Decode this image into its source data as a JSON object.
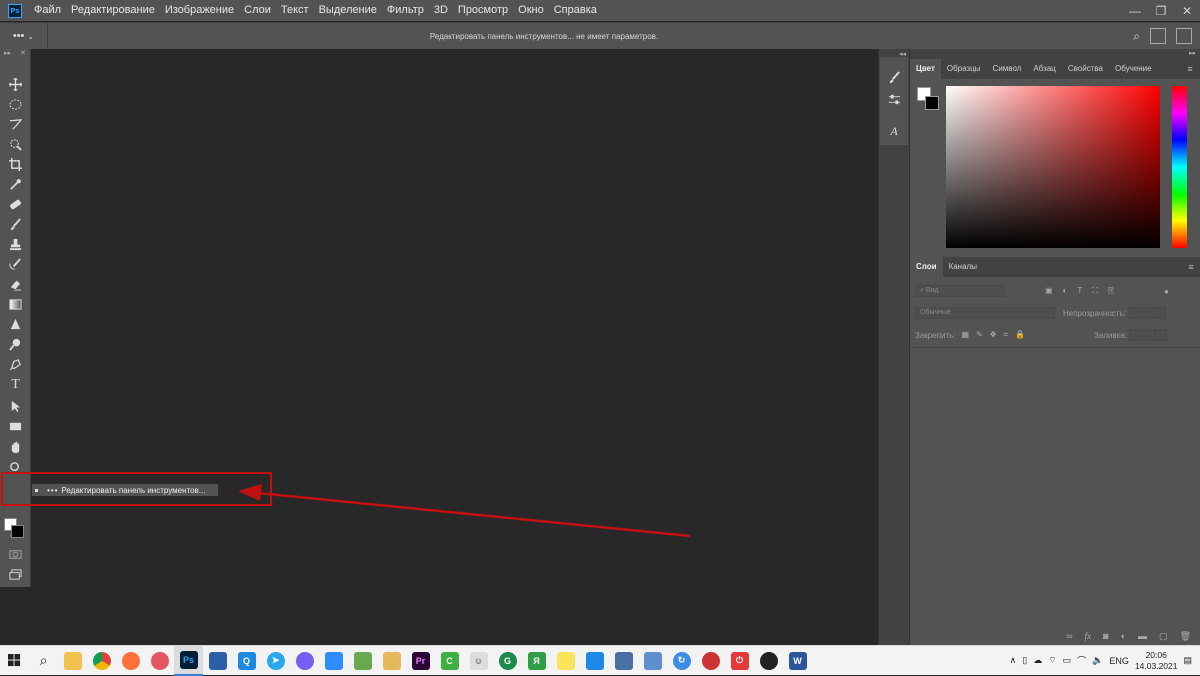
{
  "app": {
    "logo": "Ps"
  },
  "menu": [
    "Файл",
    "Редактирование",
    "Изображение",
    "Слои",
    "Текст",
    "Выделение",
    "Фильтр",
    "3D",
    "Просмотр",
    "Окно",
    "Справка"
  ],
  "window_controls": {
    "minimize": "—",
    "restore": "❐",
    "close": "✕"
  },
  "options_bar": {
    "tool_glyph": "•••",
    "message": "Редактировать панель инструментов... не имеет параметров."
  },
  "toolbox": {
    "collapse": "▸▸",
    "close": "✕",
    "more_tools": "•••"
  },
  "flyout": {
    "dots": "•••",
    "label": "Редактировать панель инструментов..."
  },
  "annotation": {
    "color": "#c21010"
  },
  "color_panel": {
    "tabs": [
      "Цвет",
      "Образцы",
      "Символ",
      "Абзац",
      "Свойства",
      "Обучение"
    ],
    "active_tab": "Цвет",
    "foreground": "#ffffff",
    "background": "#000000",
    "hue": "#ff0000"
  },
  "layers_panel": {
    "tabs": [
      "Слои",
      "Каналы"
    ],
    "active_tab": "Слои",
    "filter_placeholder": "Вид",
    "blend_mode": "Обычные",
    "opacity_label": "Непрозрачность:",
    "lock_label": "Закрепить:",
    "fill_label": "Заливка:"
  },
  "taskbar": {
    "language": "ENG",
    "time": "20:06",
    "date": "14.03.2021"
  }
}
